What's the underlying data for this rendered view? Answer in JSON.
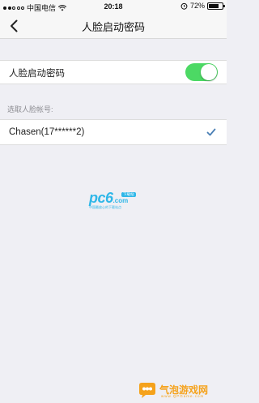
{
  "status_bar": {
    "carrier": "中国电信",
    "time": "20:18",
    "battery": "72%",
    "battery_level": 0.72,
    "icons": [
      "signal-dots-icon",
      "wifi-icon",
      "alarm-icon",
      "battery-icon"
    ]
  },
  "nav": {
    "title": "人脸启动密码",
    "back_icon": "chevron-left-icon"
  },
  "toggle": {
    "label": "人脸启动密码",
    "on": true,
    "color": "#4cd964"
  },
  "section": {
    "header": "选取人脸帐号:"
  },
  "account": {
    "label": "Chasen(17******2)",
    "selected": true,
    "check_icon": "checkmark-icon",
    "check_color": "#4a7fb5"
  },
  "watermarks": {
    "pc6": "pc6",
    "pc6_domain": ".com",
    "pc6_badge": "下载站",
    "pc6_sub": "中国最放心的下载站点",
    "qipao_name": "气泡游戏网",
    "qipao_url": "www.QPGame.com"
  }
}
